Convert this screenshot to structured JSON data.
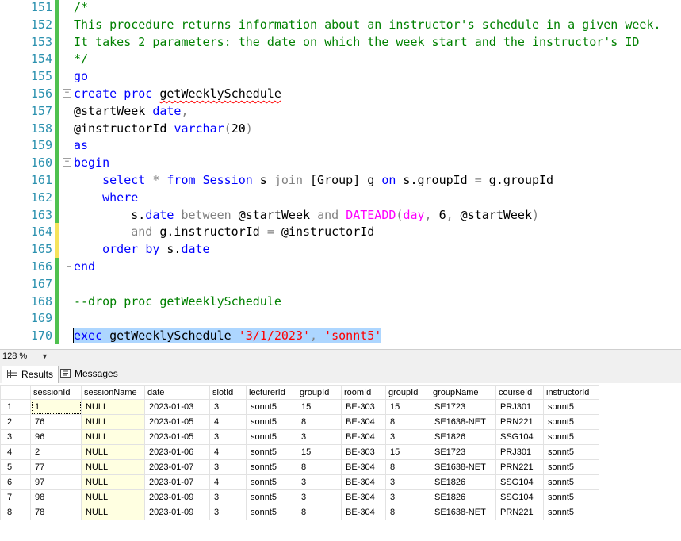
{
  "editor": {
    "lines": [
      {
        "num": "151",
        "segments": [
          {
            "c": "cm",
            "t": "/*"
          }
        ]
      },
      {
        "num": "152",
        "segments": [
          {
            "c": "cm",
            "t": "This procedure returns information about an instructor's schedule in a given week."
          }
        ]
      },
      {
        "num": "153",
        "segments": [
          {
            "c": "cm",
            "t": "It takes 2 parameters: the date on which the week start and the instructor's ID"
          }
        ]
      },
      {
        "num": "154",
        "segments": [
          {
            "c": "cm",
            "t": "*/"
          }
        ]
      },
      {
        "num": "155",
        "segments": [
          {
            "c": "kw",
            "t": "go"
          }
        ]
      },
      {
        "num": "156",
        "segments": [
          {
            "c": "kw",
            "t": "create"
          },
          {
            "c": "tx",
            "t": " "
          },
          {
            "c": "kw",
            "t": "proc"
          },
          {
            "c": "tx",
            "t": " "
          },
          {
            "c": "tx squig",
            "t": "getWeeklySchedule"
          }
        ]
      },
      {
        "num": "157",
        "segments": [
          {
            "c": "tx",
            "t": "@startWeek "
          },
          {
            "c": "kw",
            "t": "date"
          },
          {
            "c": "gr",
            "t": ","
          }
        ]
      },
      {
        "num": "158",
        "segments": [
          {
            "c": "tx",
            "t": "@instructorId "
          },
          {
            "c": "kw",
            "t": "varchar"
          },
          {
            "c": "gr",
            "t": "("
          },
          {
            "c": "tx",
            "t": "20"
          },
          {
            "c": "gr",
            "t": ")"
          }
        ]
      },
      {
        "num": "159",
        "segments": [
          {
            "c": "kw",
            "t": "as"
          }
        ]
      },
      {
        "num": "160",
        "segments": [
          {
            "c": "kw",
            "t": "begin"
          }
        ]
      },
      {
        "num": "161",
        "segments": [
          {
            "c": "tx",
            "t": "    "
          },
          {
            "c": "kw",
            "t": "select"
          },
          {
            "c": "tx",
            "t": " "
          },
          {
            "c": "gr",
            "t": "*"
          },
          {
            "c": "tx",
            "t": " "
          },
          {
            "c": "kw",
            "t": "from"
          },
          {
            "c": "tx",
            "t": " "
          },
          {
            "c": "kw",
            "t": "Session"
          },
          {
            "c": "tx",
            "t": " s "
          },
          {
            "c": "gr",
            "t": "join"
          },
          {
            "c": "tx",
            "t": " [Group] g "
          },
          {
            "c": "kw",
            "t": "on"
          },
          {
            "c": "tx",
            "t": " s.groupId "
          },
          {
            "c": "gr",
            "t": "="
          },
          {
            "c": "tx",
            "t": " g.groupId"
          }
        ]
      },
      {
        "num": "162",
        "segments": [
          {
            "c": "tx",
            "t": "    "
          },
          {
            "c": "kw",
            "t": "where"
          }
        ]
      },
      {
        "num": "163",
        "segments": [
          {
            "c": "tx",
            "t": "        s."
          },
          {
            "c": "kw",
            "t": "date"
          },
          {
            "c": "tx",
            "t": " "
          },
          {
            "c": "gr",
            "t": "between"
          },
          {
            "c": "tx",
            "t": " @startWeek "
          },
          {
            "c": "gr",
            "t": "and"
          },
          {
            "c": "tx",
            "t": " "
          },
          {
            "c": "pk",
            "t": "DATEADD"
          },
          {
            "c": "gr",
            "t": "("
          },
          {
            "c": "pk",
            "t": "day"
          },
          {
            "c": "gr",
            "t": ","
          },
          {
            "c": "tx",
            "t": " 6"
          },
          {
            "c": "gr",
            "t": ","
          },
          {
            "c": "tx",
            "t": " @startWeek"
          },
          {
            "c": "gr",
            "t": ")"
          }
        ]
      },
      {
        "num": "164",
        "segments": [
          {
            "c": "tx",
            "t": "        "
          },
          {
            "c": "gr",
            "t": "and"
          },
          {
            "c": "tx",
            "t": " g.instructorId "
          },
          {
            "c": "gr",
            "t": "="
          },
          {
            "c": "tx",
            "t": " @instructorId"
          }
        ]
      },
      {
        "num": "165",
        "segments": [
          {
            "c": "tx",
            "t": "    "
          },
          {
            "c": "kw",
            "t": "order"
          },
          {
            "c": "tx",
            "t": " "
          },
          {
            "c": "kw",
            "t": "by"
          },
          {
            "c": "tx",
            "t": " s."
          },
          {
            "c": "kw",
            "t": "date"
          }
        ]
      },
      {
        "num": "166",
        "segments": [
          {
            "c": "kw",
            "t": "end"
          }
        ]
      },
      {
        "num": "167",
        "segments": []
      },
      {
        "num": "168",
        "segments": [
          {
            "c": "cm",
            "t": "--drop proc getWeeklySchedule"
          }
        ]
      },
      {
        "num": "169",
        "segments": []
      },
      {
        "num": "170",
        "segments": [
          {
            "c": "kw sel",
            "t": "exec"
          },
          {
            "c": "tx sel",
            "t": " getWeeklySchedule "
          },
          {
            "c": "st sel",
            "t": "'3/1/2023'"
          },
          {
            "c": "gr sel",
            "t": ","
          },
          {
            "c": "tx sel",
            "t": " "
          },
          {
            "c": "st sel",
            "t": "'sonnt5'"
          }
        ]
      }
    ]
  },
  "zoom": {
    "label": "128 %"
  },
  "tabs": {
    "results": "Results",
    "messages": "Messages"
  },
  "results": {
    "columns": [
      "sessionId",
      "sessionName",
      "date",
      "slotId",
      "lecturerId",
      "groupId",
      "roomId",
      "groupId",
      "groupName",
      "courseId",
      "instructorId"
    ],
    "rows": [
      [
        "1",
        "1",
        "NULL",
        "2023-01-03",
        "3",
        "sonnt5",
        "15",
        "BE-303",
        "15",
        "SE1723",
        "PRJ301",
        "sonnt5"
      ],
      [
        "2",
        "76",
        "NULL",
        "2023-01-05",
        "4",
        "sonnt5",
        "8",
        "BE-304",
        "8",
        "SE1638-NET",
        "PRN221",
        "sonnt5"
      ],
      [
        "3",
        "96",
        "NULL",
        "2023-01-05",
        "3",
        "sonnt5",
        "3",
        "BE-304",
        "3",
        "SE1826",
        "SSG104",
        "sonnt5"
      ],
      [
        "4",
        "2",
        "NULL",
        "2023-01-06",
        "4",
        "sonnt5",
        "15",
        "BE-303",
        "15",
        "SE1723",
        "PRJ301",
        "sonnt5"
      ],
      [
        "5",
        "77",
        "NULL",
        "2023-01-07",
        "3",
        "sonnt5",
        "8",
        "BE-304",
        "8",
        "SE1638-NET",
        "PRN221",
        "sonnt5"
      ],
      [
        "6",
        "97",
        "NULL",
        "2023-01-07",
        "4",
        "sonnt5",
        "3",
        "BE-304",
        "3",
        "SE1826",
        "SSG104",
        "sonnt5"
      ],
      [
        "7",
        "98",
        "NULL",
        "2023-01-09",
        "3",
        "sonnt5",
        "3",
        "BE-304",
        "3",
        "SE1826",
        "SSG104",
        "sonnt5"
      ],
      [
        "8",
        "78",
        "NULL",
        "2023-01-09",
        "3",
        "sonnt5",
        "8",
        "BE-304",
        "8",
        "SE1638-NET",
        "PRN221",
        "sonnt5"
      ]
    ]
  }
}
